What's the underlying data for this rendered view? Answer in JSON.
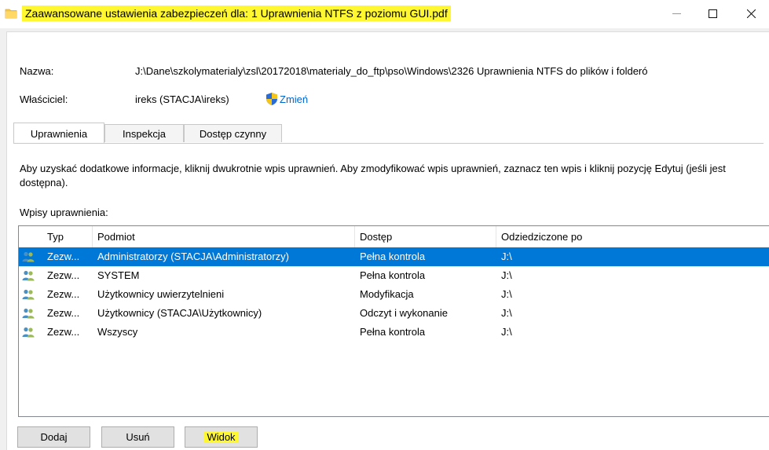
{
  "window": {
    "title": "Zaawansowane ustawienia zabezpieczeń dla: 1 Uprawnienia NTFS z poziomu GUI.pdf",
    "highlight_color": "#fff830"
  },
  "info": {
    "name_label": "Nazwa:",
    "name_value": "J:\\Dane\\szkolymaterialy\\zsl\\20172018\\materialy_do_ftp\\pso\\Windows\\2326 Uprawnienia NTFS do plików i folderó",
    "owner_label": "Właściciel:",
    "owner_value": "ireks (STACJA\\ireks)",
    "change_link": "Zmień",
    "link_color": "#0066cc"
  },
  "tabs": [
    {
      "label": "Uprawnienia",
      "active": true
    },
    {
      "label": "Inspekcja",
      "active": false
    },
    {
      "label": "Dostęp czynny",
      "active": false
    }
  ],
  "description": "Aby uzyskać dodatkowe informacje, kliknij dwukrotnie wpis uprawnień. Aby zmodyfikować wpis uprawnień, zaznacz ten wpis i kliknij pozycję Edytuj (jeśli jest dostępna).",
  "entries_label": "Wpisy uprawnienia:",
  "table": {
    "columns": [
      "Typ",
      "Podmiot",
      "Dostęp",
      "Odziedziczone po"
    ],
    "rows": [
      {
        "type": "Zezw...",
        "principal": "Administratorzy (STACJA\\Administratorzy)",
        "access": "Pełna kontrola",
        "inherited": "J:\\",
        "selected": true
      },
      {
        "type": "Zezw...",
        "principal": "SYSTEM",
        "access": "Pełna kontrola",
        "inherited": "J:\\",
        "selected": false
      },
      {
        "type": "Zezw...",
        "principal": "Użytkownicy uwierzytelnieni",
        "access": "Modyfikacja",
        "inherited": "J:\\",
        "selected": false
      },
      {
        "type": "Zezw...",
        "principal": "Użytkownicy (STACJA\\Użytkownicy)",
        "access": "Odczyt i wykonanie",
        "inherited": "J:\\",
        "selected": false
      },
      {
        "type": "Zezw...",
        "principal": "Wszyscy",
        "access": "Pełna kontrola",
        "inherited": "J:\\",
        "selected": false
      }
    ],
    "selection_color": "#0078d7"
  },
  "buttons": {
    "add": "Dodaj",
    "remove": "Usuń",
    "view": "Widok"
  }
}
